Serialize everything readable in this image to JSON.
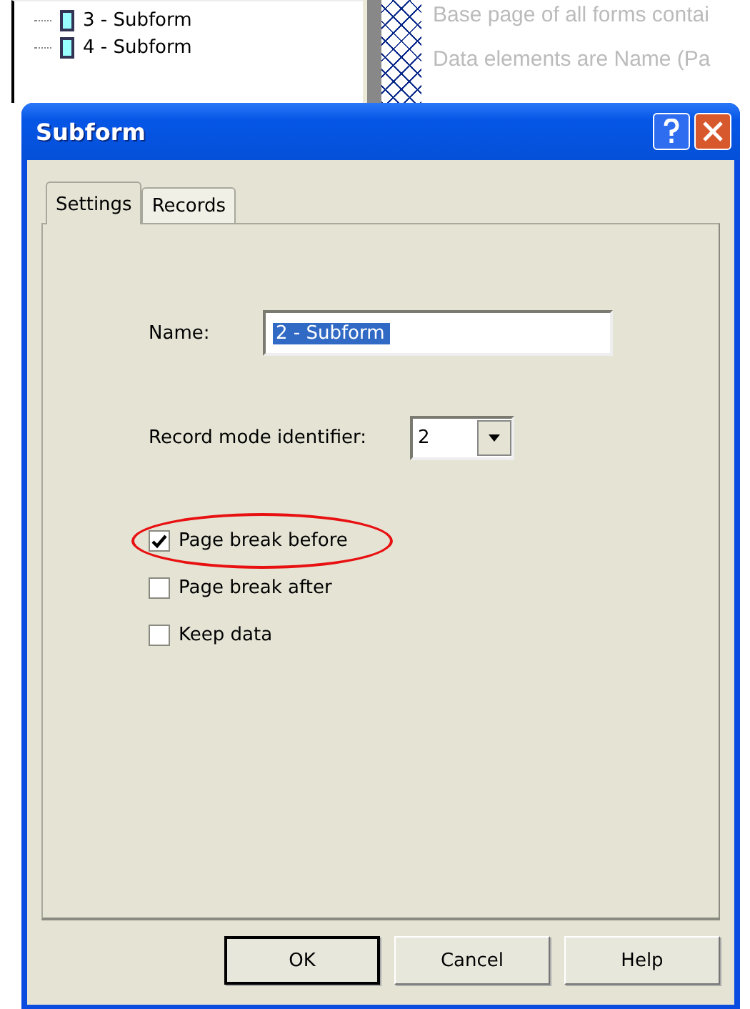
{
  "background": {
    "tree_items": [
      {
        "label": "3 - Subform"
      },
      {
        "label": "4 - Subform"
      }
    ],
    "descriptions": [
      "Base page of all forms contai",
      "Data elements are Name (Pa"
    ]
  },
  "dialog": {
    "title": "Subform",
    "tabs": [
      {
        "label": "Settings",
        "selected": true
      },
      {
        "label": "Records",
        "selected": false
      }
    ],
    "name_field": {
      "label": "Name:",
      "value": "2 - Subform"
    },
    "record_mode": {
      "label": "Record mode identifier:",
      "value": "2"
    },
    "checkboxes": [
      {
        "label": "Page break before",
        "checked": true
      },
      {
        "label": "Page break after",
        "checked": false
      },
      {
        "label": "Keep data",
        "checked": false
      }
    ],
    "buttons": [
      {
        "label": "OK",
        "default": true
      },
      {
        "label": "Cancel",
        "default": false
      },
      {
        "label": "Help",
        "default": false
      }
    ]
  }
}
